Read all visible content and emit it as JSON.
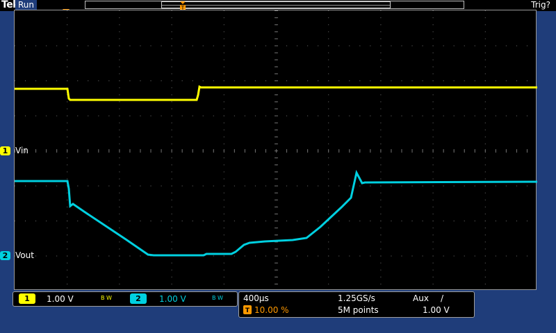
{
  "topbar": {
    "brand": "Tek",
    "run_status": "Run",
    "trigger_status": "Trig?"
  },
  "trigger": {
    "marker_letter": "T",
    "position_percent": 10.0
  },
  "channels": [
    {
      "id": "1",
      "label": "Vin",
      "color": "#ffff00",
      "scale": "1.00 V",
      "bw_limit": "B W"
    },
    {
      "id": "2",
      "label": "Vout",
      "color": "#00d0e0",
      "scale": "1.00 V",
      "bw_limit": "B W"
    }
  ],
  "timebase": {
    "scale": "400µs",
    "sample_rate": "1.25GS/s",
    "trigger_source": "Aux",
    "trigger_slope": "/",
    "position": "10.00 %",
    "record_length": "5M points",
    "trigger_level": "1.00 V"
  },
  "colors": {
    "background": "#1f3d7a",
    "screen": "#000000",
    "grid_dots": "#707070",
    "ch1": "#ffff00",
    "ch2": "#00d0e0",
    "trigger_orange": "#ff9900"
  },
  "icons": [
    "trigger-position-icon",
    "channel-1-chip-icon",
    "channel-2-chip-icon",
    "trigger-slope-icon"
  ]
}
